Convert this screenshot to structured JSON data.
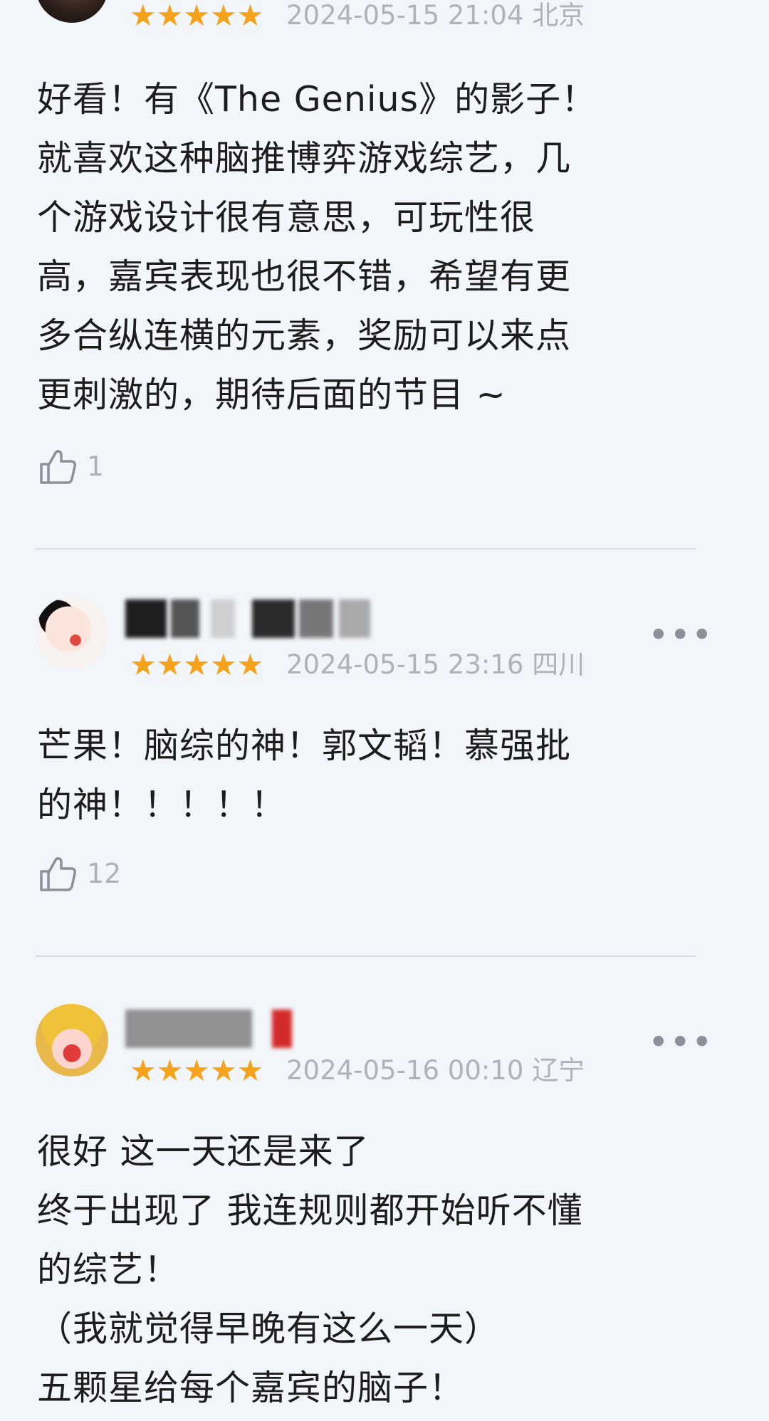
{
  "reviews": [
    {
      "stars": "★★★★★",
      "datetime": "2024-05-15 21:04",
      "location": "北京",
      "text": "好看！有《The Genius》的影子！\n就喜欢这种脑推博弈游戏综艺，几\n个游戏设计很有意思，可玩性很\n高，嘉宾表现也很不错，希望有更\n多合纵连横的元素，奖励可以来点\n更刺激的，期待后面的节目 ~",
      "likes": "1"
    },
    {
      "stars": "★★★★★",
      "datetime": "2024-05-15 23:16",
      "location": "四川",
      "text": "芒果！脑综的神！郭文韬！慕强批\n的神！！！！！",
      "likes": "12",
      "more": "•••"
    },
    {
      "stars": "★★★★★",
      "datetime": "2024-05-16 00:10",
      "location": "辽宁",
      "text": "很好 这一天还是来了\n终于出现了 我连规则都开始听不懂\n的综艺！\n（我就觉得早晚有这么一天）\n五颗星给每个嘉宾的脑子！",
      "more": "•••"
    }
  ]
}
